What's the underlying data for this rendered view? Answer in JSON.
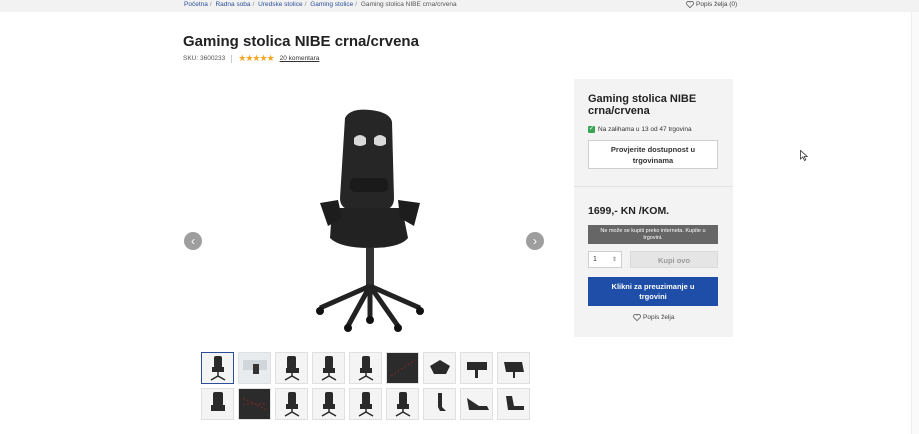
{
  "breadcrumb": [
    {
      "label": "Početna",
      "link": true
    },
    {
      "label": "Radna soba",
      "link": true
    },
    {
      "label": "Uredske stolice",
      "link": true
    },
    {
      "label": "Gaming stolice",
      "link": true
    },
    {
      "label": "Gaming stolica NIBE crna/crvena",
      "link": false
    }
  ],
  "header": {
    "wishlist_label": "Popis želja (0)"
  },
  "product": {
    "title": "Gaming stolica NIBE crna/crvena",
    "sku": "SKU: 3600233",
    "rating": 4.5,
    "rating_stars": "★★★★★",
    "reviews_label": "20 komentara"
  },
  "gallery": {
    "prev_icon": "‹",
    "next_icon": "›",
    "thumbnail_count": 18,
    "active_index": 0
  },
  "panel": {
    "title": "Gaming stolica NIBE crna/crvena",
    "stock_text": "Na zalihama u 13 od 47 trgovina",
    "check_availability_label": "Provjerite dostupnost u trgovinama",
    "price": "1699,- KN /KOM.",
    "notice": "Ne može se kupiti preko interneta. Kupite u trgovini.",
    "quantity": "1",
    "buy_label": "Kupi ovo",
    "pickup_label": "Klikni za preuzimanje u trgovini",
    "wishlist_label": "Popis želja"
  },
  "colors": {
    "accent": "#1e4ea8",
    "star": "#f5a623",
    "stock_ok": "#3aa655"
  }
}
